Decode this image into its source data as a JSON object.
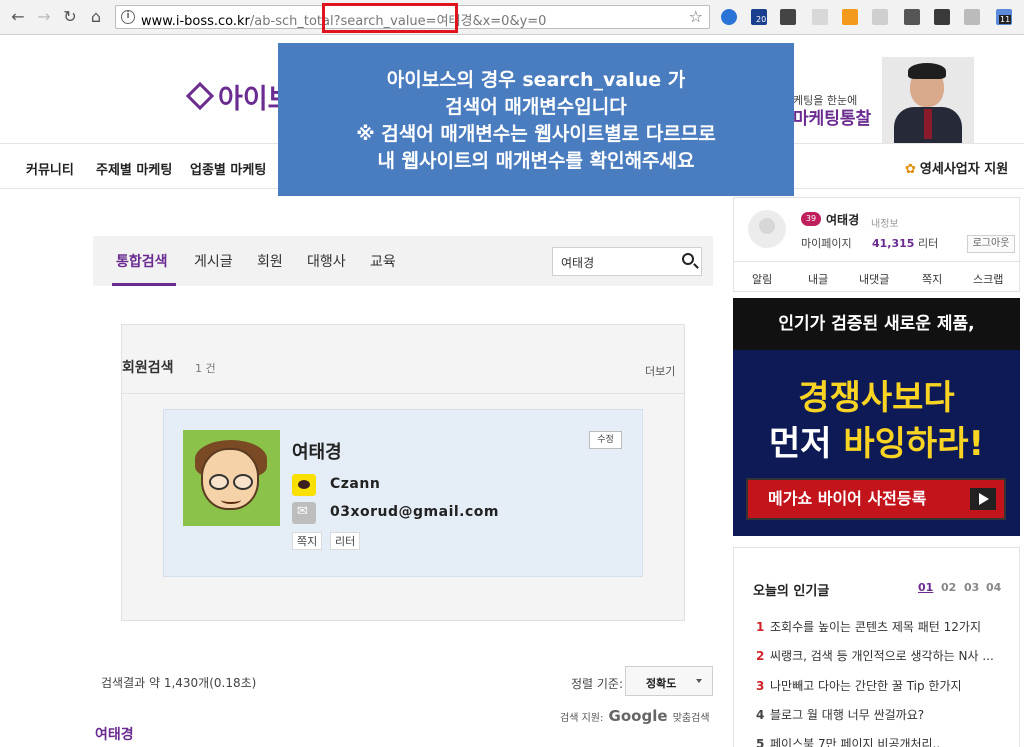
{
  "browser": {
    "url_host": "www.i-boss.co.kr",
    "url_rest": "/ab-sch_total?search_value=여태경&x=0&y=0",
    "ext_badges": [
      "20",
      "11"
    ]
  },
  "site": {
    "logo_text": "아이보",
    "promo_line1": "케팅을 한눈에",
    "promo_line2": "마케팅통찰"
  },
  "gnb": {
    "items": [
      "커뮤니티",
      "주제별 마케팅",
      "업종별 마케팅"
    ],
    "right": "영세사업자 지원"
  },
  "overlay": {
    "lines": [
      "아이보스의 경우 search_value 가",
      "검색어 매개변수입니다",
      "※ 검색어 매개변수는 웹사이트별로 다르므로",
      "내 웹사이트의 매개변수를 확인해주세요"
    ]
  },
  "search": {
    "tabs": [
      "통합검색",
      "게시글",
      "회원",
      "대행사",
      "교육"
    ],
    "query": "여태경"
  },
  "member_panel": {
    "title": "회원검색",
    "count": "1 건",
    "more": "더보기",
    "card": {
      "name": "여태경",
      "edit": "수정",
      "kakao": "Czann",
      "email": "03xorud@gmail.com",
      "actions": [
        "쪽지",
        "리터"
      ]
    }
  },
  "results": {
    "count_text": "검색결과 약 1,430개(0.18초)",
    "sort_label": "정렬 기준:",
    "sort_value": "정확도",
    "provider_prefix": "검색 지원:",
    "provider_name": "Google",
    "provider_suffix": "맞춤검색",
    "first_heading": "여태경"
  },
  "sidebar": {
    "user": {
      "level": "39",
      "name": "여태경",
      "myinfo": "내정보",
      "mypage": "마이페이지",
      "points": "41,315",
      "points_unit": "리터",
      "logout": "로그아웃",
      "tabs": [
        "알림",
        "내글",
        "내댓글",
        "쪽지",
        "스크랩"
      ]
    },
    "ad": {
      "top": "인기가 검증된 새로운 제품,",
      "line1": "경쟁사보다",
      "line2_a": "먼저 ",
      "line2_b": "바잉하라!",
      "button": "메가쇼 바이어 사전등록"
    },
    "popular": {
      "title": "오늘의 인기글",
      "pages": [
        "01",
        "02",
        "03",
        "04"
      ],
      "items": [
        {
          "num": "1",
          "text": "조회수를 높이는 콘텐츠 제목 패턴 12가지"
        },
        {
          "num": "2",
          "text": "씨랭크, 검색 등 개인적으로 생각하는 N사 ..."
        },
        {
          "num": "3",
          "text": "나만빼고 다아는 간단한 꿀 Tip 한가지"
        },
        {
          "num": "4",
          "text": "블로그 월 대행 너무 싼걸까요?"
        },
        {
          "num": "5",
          "text": "페이스북 7만 페이지 비공개처리.."
        }
      ]
    }
  },
  "colors": {
    "brand": "#6b2c91",
    "overlay": "#4a7cc0",
    "highlight": "#e0141e"
  }
}
